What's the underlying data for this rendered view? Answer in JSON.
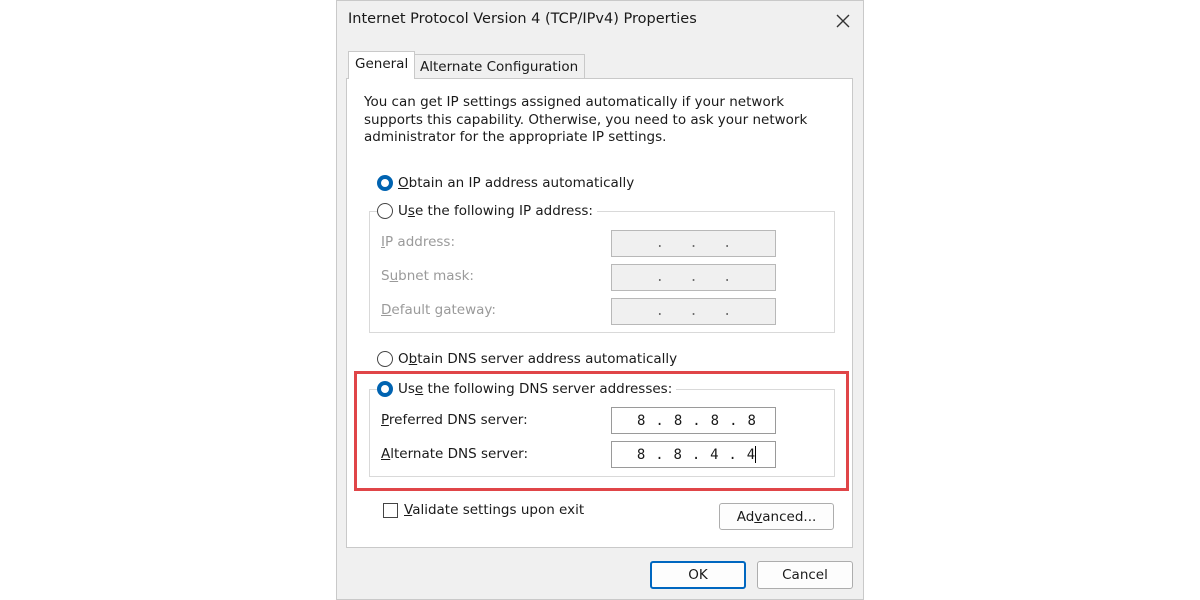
{
  "window": {
    "title": "Internet Protocol Version 4 (TCP/IPv4) Properties",
    "close_icon": "close-icon"
  },
  "tabs": [
    {
      "label": "General",
      "selected": true
    },
    {
      "label": "Alternate Configuration",
      "selected": false
    }
  ],
  "description": "You can get IP settings assigned automatically if your network supports this capability. Otherwise, you need to ask your network administrator for the appropriate IP settings.",
  "ip_section": {
    "auto_label_accel": "O",
    "auto_label_rest": "btain an IP address automatically",
    "manual_label_pre": "U",
    "manual_label_accel": "s",
    "manual_label_rest": "e the following IP address:",
    "auto_selected": true,
    "fields": [
      {
        "label_accel": "I",
        "label_rest": "P address:"
      },
      {
        "label_pre": "S",
        "label_accel": "u",
        "label_rest": "bnet mask:"
      },
      {
        "label_accel": "D",
        "label_rest": "efault gateway:"
      }
    ]
  },
  "dns_section": {
    "auto_label_pre": "O",
    "auto_label_accel": "b",
    "auto_label_rest": "tain DNS server address automatically",
    "manual_label_pre": "Us",
    "manual_label_accel": "e",
    "manual_label_rest": " the following DNS server addresses:",
    "manual_selected": true,
    "preferred": {
      "label_accel": "P",
      "label_rest": "referred DNS server:",
      "octets": [
        "8",
        "8",
        "8",
        "8"
      ]
    },
    "alternate": {
      "label_accel": "A",
      "label_rest": "lternate DNS server:",
      "octets": [
        "8",
        "8",
        "4",
        "4"
      ]
    }
  },
  "validate": {
    "label_accel": "V",
    "label_rest": "alidate settings upon exit",
    "checked": false
  },
  "buttons": {
    "advanced_pre": "Ad",
    "advanced_accel": "v",
    "advanced_rest": "anced...",
    "ok": "OK",
    "cancel": "Cancel"
  },
  "colors": {
    "highlight": "#e04548",
    "radio_selected": "#0063b1",
    "ok_border": "#0067c0"
  }
}
